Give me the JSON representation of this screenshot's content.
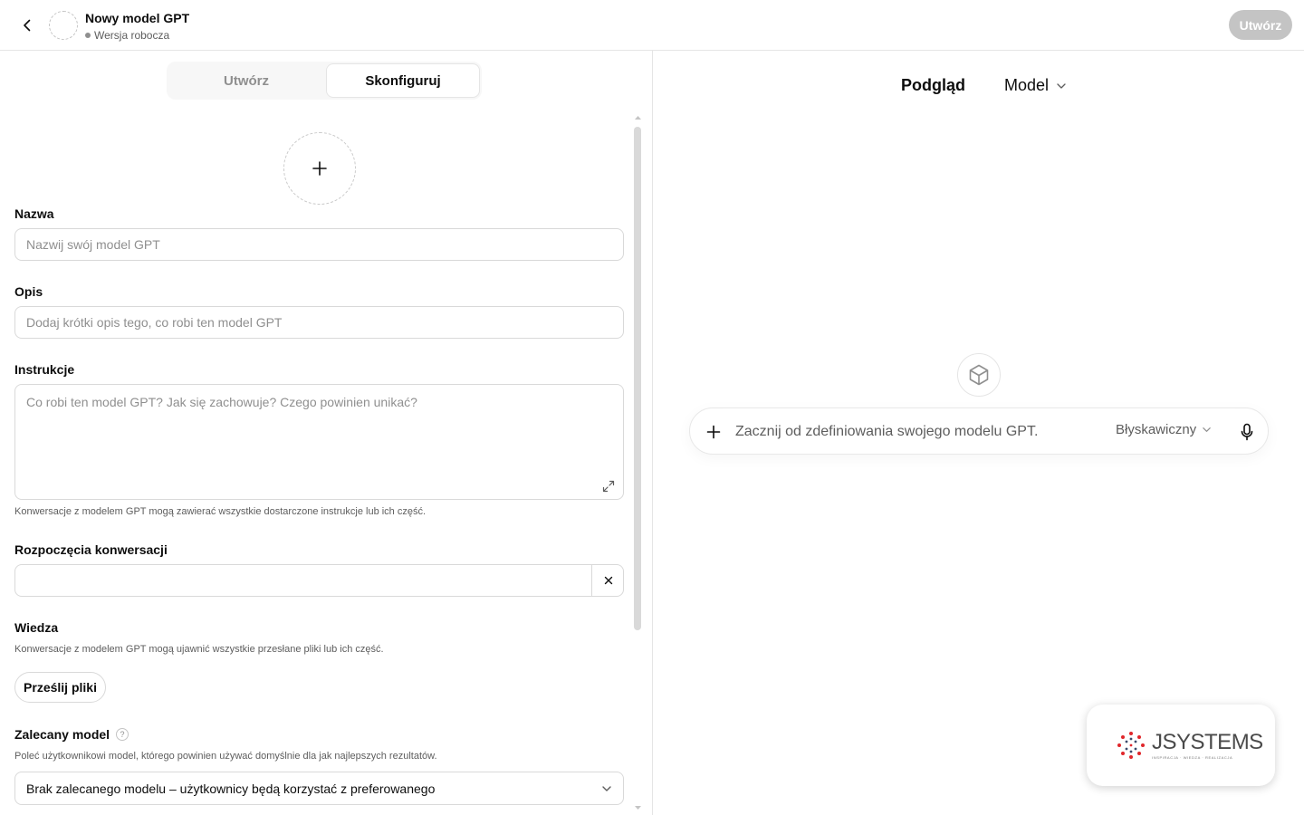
{
  "header": {
    "title": "Nowy model GPT",
    "status": "Wersja robocza",
    "create_label": "Utwórz"
  },
  "tabs": {
    "create": "Utwórz",
    "configure": "Skonfiguruj"
  },
  "form": {
    "name_label": "Nazwa",
    "name_placeholder": "Nazwij swój model GPT",
    "name_value": "",
    "description_label": "Opis",
    "description_placeholder": "Dodaj krótki opis tego, co robi ten model GPT",
    "description_value": "",
    "instructions_label": "Instrukcje",
    "instructions_placeholder": "Co robi ten model GPT? Jak się zachowuje? Czego powinien unikać?",
    "instructions_hint": "Konwersacje z modelem GPT mogą zawierać wszystkie dostarczone instrukcje lub ich część.",
    "starters_label": "Rozpoczęcia konwersacji",
    "starter_value": "",
    "knowledge_label": "Wiedza",
    "knowledge_hint": "Konwersacje z modelem GPT mogą ujawnić wszystkie przesłane pliki lub ich część.",
    "upload_label": "Prześlij pliki",
    "recommended_model_label": "Zalecany model",
    "recommended_model_help": "?",
    "recommended_model_hint": "Poleć użytkownikowi model, którego powinien używać domyślnie dla jak najlepszych rezultatów.",
    "recommended_model_value": "Brak zalecanego modelu – użytkownicy będą korzystać z preferowanego"
  },
  "preview": {
    "title": "Podgląd",
    "model_label": "Model",
    "composer_placeholder": "Zacznij od zdefiniowania swojego modelu GPT.",
    "speed_label": "Błyskawiczny"
  },
  "logo": {
    "main": "JSYSTEMS",
    "sub": "INSPIRACJA · WIEDZA · REALIZACJA"
  }
}
